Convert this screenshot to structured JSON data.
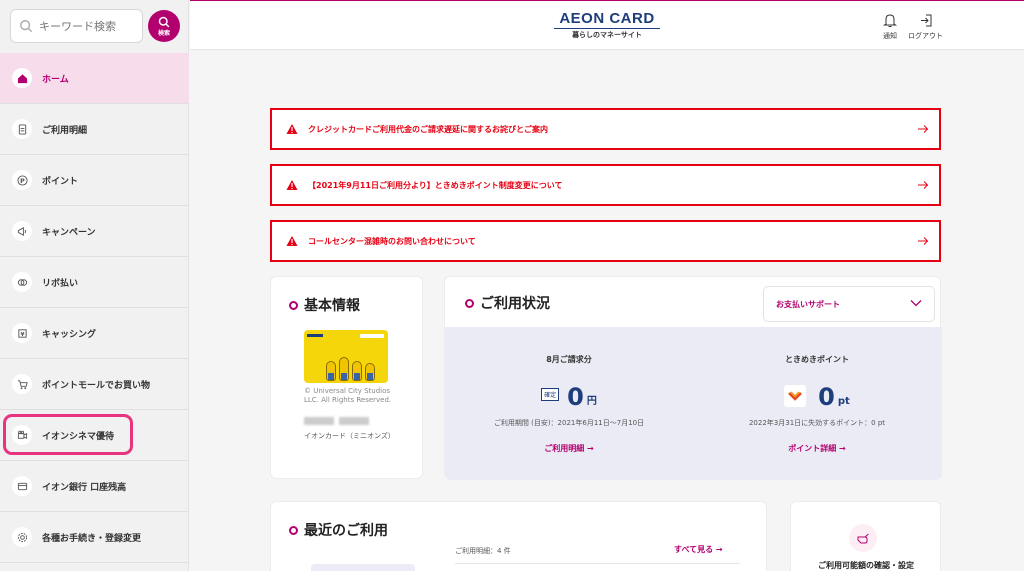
{
  "search": {
    "placeholder": "キーワード検索",
    "button_label": "検索"
  },
  "sidebar": {
    "items": [
      {
        "label": "ホーム",
        "icon": "home-icon"
      },
      {
        "label": "ご利用明細",
        "icon": "document-icon"
      },
      {
        "label": "ポイント",
        "icon": "points-icon"
      },
      {
        "label": "キャンペーン",
        "icon": "megaphone-icon"
      },
      {
        "label": "リボ払い",
        "icon": "revolving-icon"
      },
      {
        "label": "キャッシング",
        "icon": "cash-icon"
      },
      {
        "label": "ポイントモールでお買い物",
        "icon": "cart-icon"
      },
      {
        "label": "イオンシネマ優待",
        "icon": "cinema-icon"
      },
      {
        "label": "イオン銀行 口座残高",
        "icon": "bank-icon"
      },
      {
        "label": "各種お手続き・登録変更",
        "icon": "settings-icon"
      }
    ]
  },
  "header": {
    "brand": "AEON CARD",
    "tagline": "暮らしのマネーサイト",
    "notify_label": "通知",
    "logout_label": "ログアウト"
  },
  "notices": [
    {
      "text": "クレジットカードご利用代金のご請求遅延に関するお詫びとご案内"
    },
    {
      "text": "【2021年9月11日ご利用分より】ときめきポイント制度変更について"
    },
    {
      "text": "コールセンター混雑時のお問い合わせについて"
    }
  ],
  "basic_info": {
    "title": "基本情報",
    "copyright": "© Universal City Studios LLC. All Rights Reserved.",
    "card_name": "イオンカード（ミニオンズ）"
  },
  "usage": {
    "title": "ご利用状況",
    "support_dropdown": "お支払いサポート",
    "billing": {
      "title": "8月ご請求分",
      "status_tag": "確定",
      "amount": "0",
      "unit": "円",
      "period": "ご利用期間 (目安)：2021年6月11日〜7月10日",
      "link": "ご利用明細 →"
    },
    "points": {
      "title": "ときめきポイント",
      "amount": "0",
      "unit": "pt",
      "expiry": "2022年3月31日に失効するポイント：0 pt",
      "link": "ポイント詳細 →"
    }
  },
  "recent": {
    "title": "最近のご利用",
    "meta": "ご利用明細：4 件",
    "see_all": "すべて見る →"
  },
  "limit": {
    "label": "ご利用可能額の確認・設定"
  },
  "colors": {
    "brand": "#b3006f",
    "navy": "#1e3d7b",
    "alert": "#e60012"
  }
}
